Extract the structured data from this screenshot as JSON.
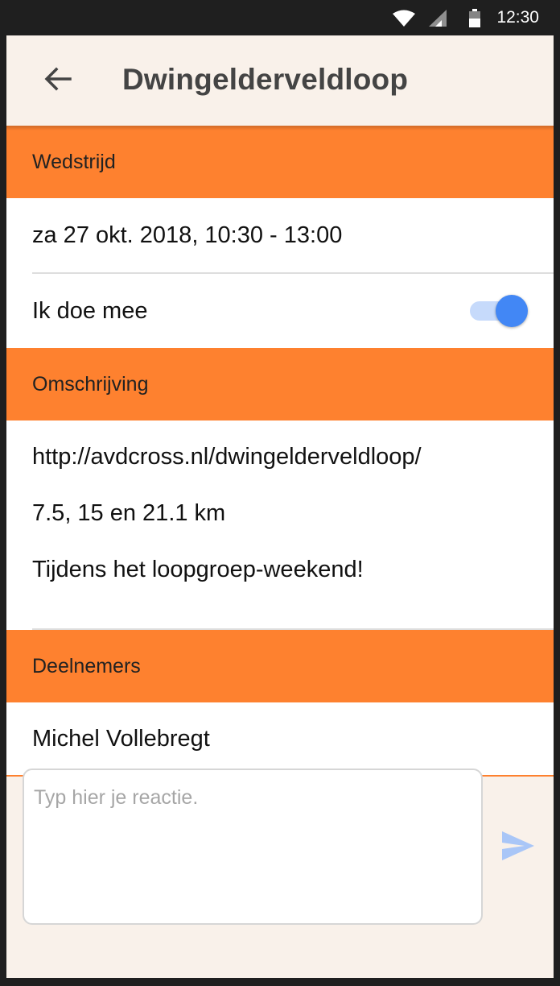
{
  "status_bar": {
    "time": "12:30"
  },
  "header": {
    "title": "Dwingelderveldloop"
  },
  "sections": {
    "event": {
      "header": "Wedstrijd",
      "datetime": "za 27 okt. 2018, 10:30 - 13:00",
      "participate_label": "Ik doe mee",
      "participate_on": true
    },
    "description": {
      "header": "Omschrijving",
      "lines": [
        "http://avdcross.nl/dwingelderveldloop/",
        "7.5, 15 en 21.1 km",
        "Tijdens het loopgroep-weekend!"
      ]
    },
    "participants": {
      "header": "Deelnemers",
      "names": [
        "Michel Vollebregt"
      ]
    }
  },
  "comment": {
    "placeholder": "Typ hier je reactie.",
    "value": ""
  },
  "colors": {
    "section_header": "#fe812f",
    "background": "#f9f1ea",
    "toggle_accent": "#4287f5",
    "send_icon": "#a9c6f7"
  },
  "icons": {
    "back": "arrow-left-icon",
    "send": "send-icon",
    "wifi": "wifi-icon",
    "signal": "signal-icon",
    "battery": "battery-icon"
  }
}
